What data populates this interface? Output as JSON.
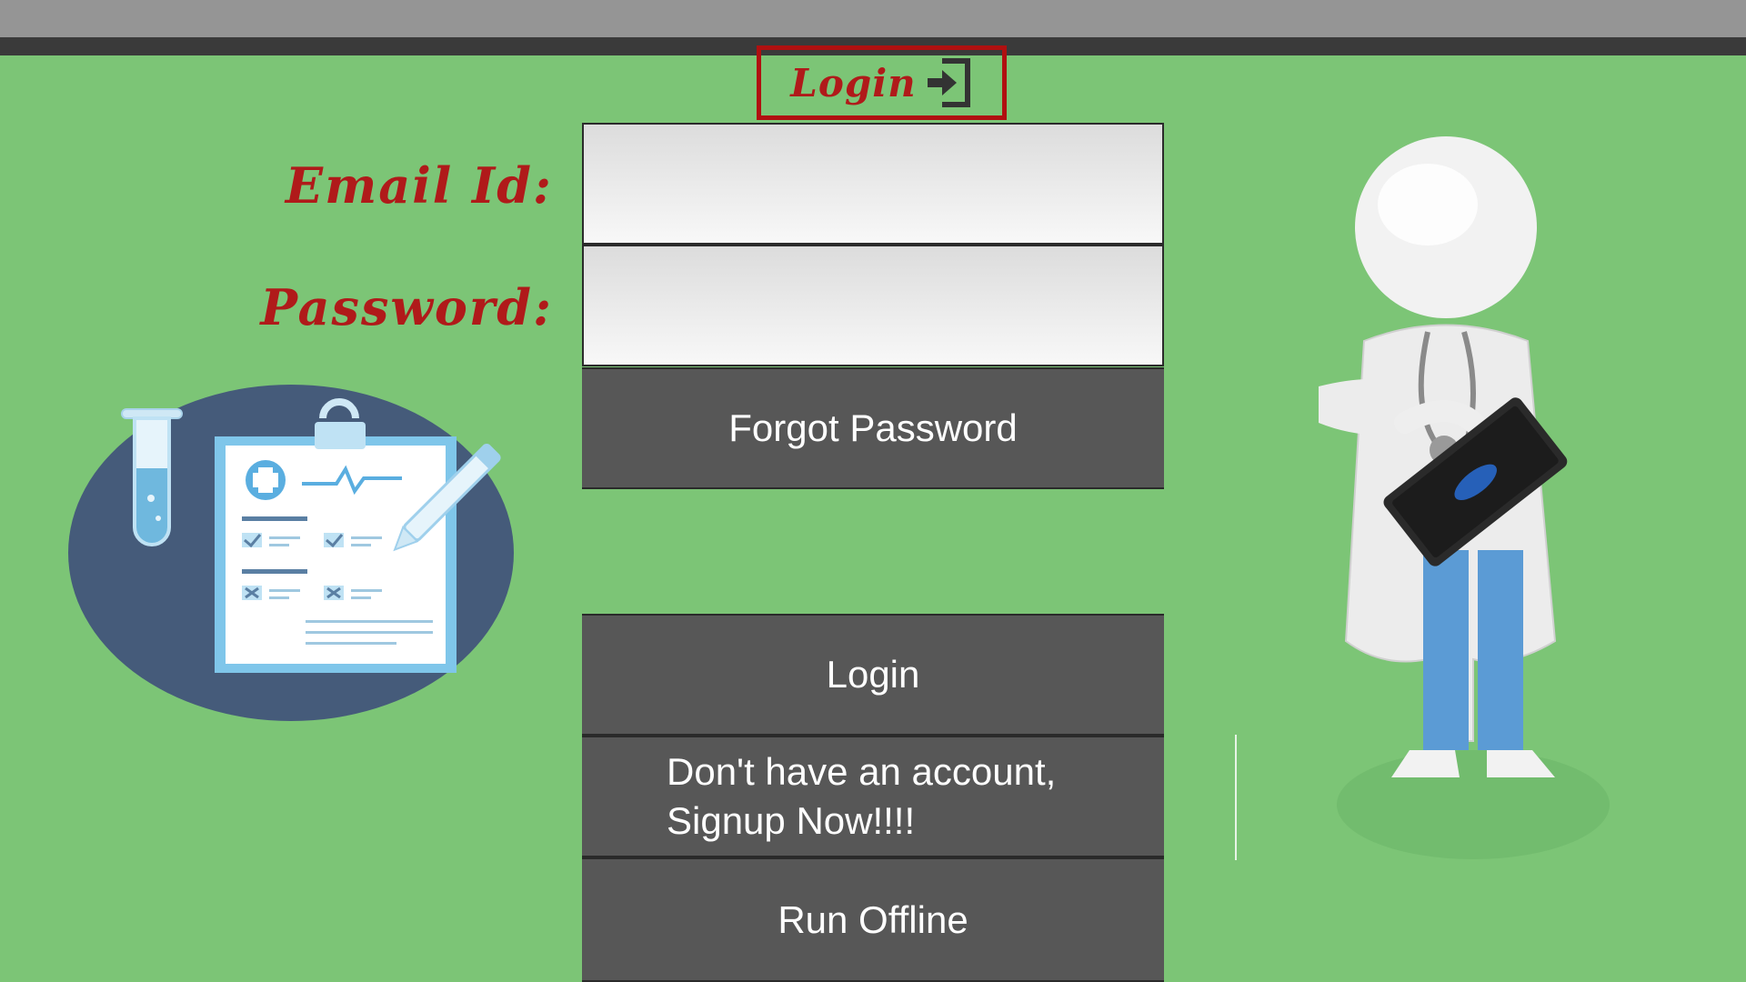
{
  "header": {
    "title": "Login"
  },
  "form": {
    "email_label": "Email Id:",
    "password_label": "Password:",
    "email_value": "",
    "password_value": ""
  },
  "buttons": {
    "forgot_password": "Forgot Password",
    "login": "Login",
    "signup_line1": "Don't have an account,",
    "signup_line2": "Signup Now!!!!",
    "run_offline": "Run Offline"
  },
  "colors": {
    "background": "#7cc576",
    "label_red": "#b01a1a",
    "button_gray": "#575757",
    "header_border": "#b01010"
  },
  "icons": [
    "login-arrow-icon",
    "clipboard-illustration",
    "test-tube-icon",
    "doctor-figure-illustration"
  ]
}
